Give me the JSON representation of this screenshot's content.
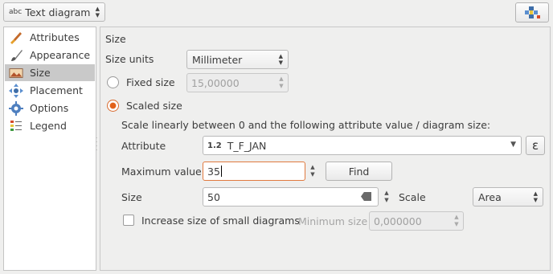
{
  "top": {
    "renderer": "Text diagram",
    "renderer_prefix": "abc"
  },
  "sidebar": {
    "items": [
      {
        "label": "Attributes",
        "icon": "paintbrush-icon"
      },
      {
        "label": "Appearance",
        "icon": "brush-icon"
      },
      {
        "label": "Size",
        "icon": "size-image-icon",
        "selected": true
      },
      {
        "label": "Placement",
        "icon": "placement-arrows-icon"
      },
      {
        "label": "Options",
        "icon": "options-gear-icon"
      },
      {
        "label": "Legend",
        "icon": "legend-icon"
      }
    ]
  },
  "size": {
    "section_title": "Size",
    "units_label": "Size units",
    "units_value": "Millimeter",
    "fixed_label": "Fixed size",
    "fixed_value": "15,00000",
    "scaled_label": "Scaled size",
    "scale_desc": "Scale linearly between 0 and the following attribute value / diagram size:",
    "attribute_label": "Attribute",
    "attribute_type": "1.2",
    "attribute_value": "T_F_JAN",
    "expression_glyph": "ε",
    "max_label": "Maximum value",
    "max_value": "35",
    "find_label": "Find",
    "size_label": "Size",
    "size_value": "50",
    "scale_label": "Scale",
    "scale_value": "Area",
    "increase_label": "Increase size of small diagrams",
    "min_label": "Minimum size",
    "min_value": "0,000000"
  },
  "colors": {
    "accent": "#e2621b",
    "selected_row": "#c9c9c9"
  }
}
